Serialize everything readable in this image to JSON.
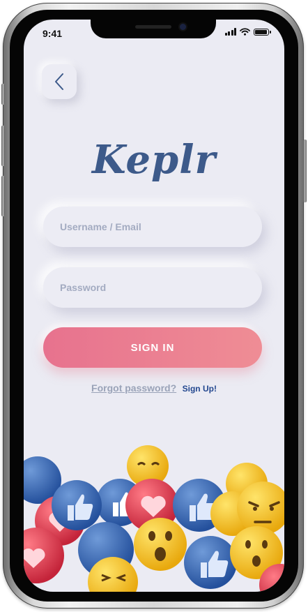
{
  "status_bar": {
    "time": "9:41"
  },
  "app": {
    "logo_text": "Keplr"
  },
  "form": {
    "username_placeholder": "Username / Email",
    "password_placeholder": "Password",
    "signin_label": "SIGN IN",
    "forgot_label": "Forgot password?",
    "signup_label": "Sign Up!"
  },
  "icons": {
    "back": "chevron-left-icon",
    "signal": "signal-icon",
    "wifi": "wifi-icon",
    "battery": "battery-icon",
    "decoration": [
      "like-icon",
      "heart-icon",
      "wow-emoji-icon",
      "angry-emoji-icon",
      "laugh-emoji-icon"
    ]
  },
  "colors": {
    "background": "#ebebf3",
    "accent": "#e7728e",
    "logo": "#3d5a8a",
    "link": "#23478f",
    "like_blue": "#2f5fae",
    "heart_red": "#e23b4e",
    "emoji_yellow": "#f6c21c"
  }
}
